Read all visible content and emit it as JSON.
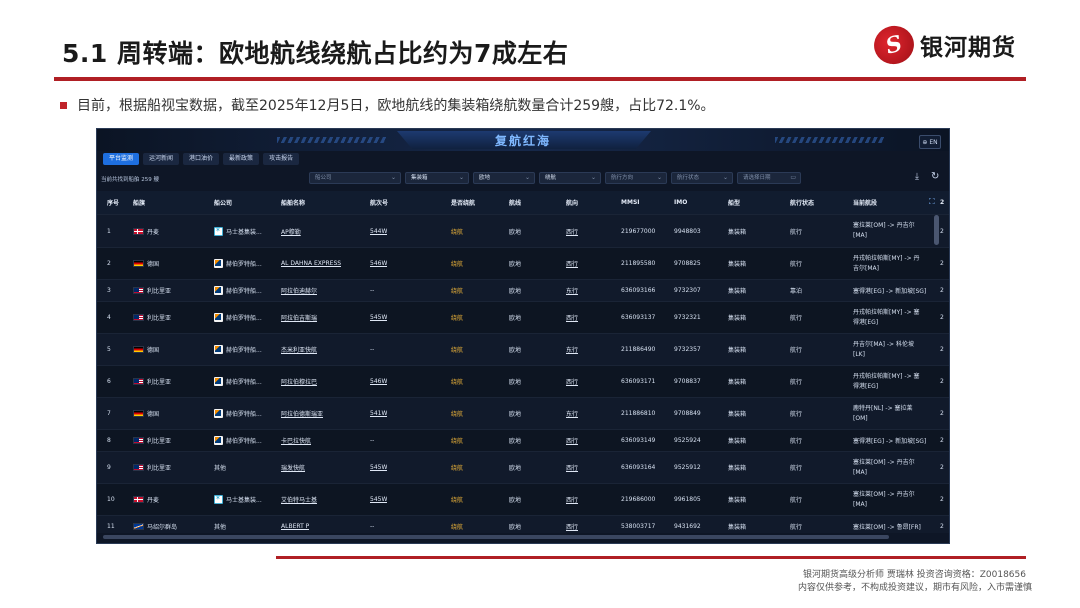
{
  "slide": {
    "title": "5.1 周转端：欧地航线绕航占比约为7成左右",
    "logo_text": "银河期货",
    "bullet": "目前，根据船视宝数据，截至2025年12月5日，欧地航线的集装箱绕航数量合计259艘，占比72.1%。",
    "footer_line1": "银河期货高级分析师 贾瑞林 投资咨询资格：Z0018656",
    "footer_line2": "内容仅供参考，不构成投资建议，期市有风险，入市需谨慎",
    "accent_color": "#b01f24"
  },
  "app": {
    "title": "复航红海",
    "lang_button": "⊕ EN",
    "tabs": [
      "平台监测",
      "运河新闻",
      "港口油价",
      "最新政策",
      "攻击报告"
    ],
    "count_text": "当前共找到船舶 259 艘",
    "filters": {
      "company": "船公司",
      "ship_type": "集装箱",
      "route": "欧地",
      "detour": "绕航",
      "direction": "航行方向",
      "status": "航行状态",
      "date": "请选择日期"
    },
    "columns": [
      "序号",
      "船旗",
      "船公司",
      "船舶名称",
      "航次号",
      "是否绕航",
      "航线",
      "航向",
      "MMSI",
      "IMO",
      "船型",
      "航行状态",
      "当前航段",
      "2"
    ],
    "rows": [
      {
        "no": "1",
        "flag": "丹麦",
        "company": "马士基集装...",
        "ship": "AP穆勒",
        "voyage": "544W",
        "detour": "绕航",
        "route": "欧地",
        "heading": "西行",
        "mmsi": "219677000",
        "imo": "9948803",
        "type": "集装箱",
        "status": "航行",
        "leg": "塞拉莱[OM] -> 丹吉尔",
        "leg2": "[MA]",
        "extra": "2"
      },
      {
        "no": "2",
        "flag": "德国",
        "company": "赫伯罗特船...",
        "ship": "AL DAHNA EXPRESS",
        "voyage": "546W",
        "detour": "绕航",
        "route": "欧地",
        "heading": "西行",
        "mmsi": "211895580",
        "imo": "9708825",
        "type": "集装箱",
        "status": "航行",
        "leg": "丹戎帕拉帕斯[MY] -> 丹",
        "leg2": "吉尔[MA]",
        "extra": "2"
      },
      {
        "no": "3",
        "flag": "利比里亚",
        "company": "赫伯罗特船...",
        "ship": "阿拉伯迪赫尔",
        "voyage": "--",
        "detour": "绕航",
        "route": "欧地",
        "heading": "东行",
        "mmsi": "636093166",
        "imo": "9732307",
        "type": "集装箱",
        "status": "靠泊",
        "leg": "塞得港[EG] -> 新加坡[SG]",
        "leg2": "",
        "extra": "2"
      },
      {
        "no": "4",
        "flag": "利比里亚",
        "company": "赫伯罗特船...",
        "ship": "阿拉伯吉斯瑞",
        "voyage": "545W",
        "detour": "绕航",
        "route": "欧地",
        "heading": "西行",
        "mmsi": "636093137",
        "imo": "9732321",
        "type": "集装箱",
        "status": "航行",
        "leg": "丹戎帕拉帕斯[MY] -> 塞",
        "leg2": "得港[EG]",
        "extra": "2"
      },
      {
        "no": "5",
        "flag": "德国",
        "company": "赫伯罗特船...",
        "ship": "杰米利亚快航",
        "voyage": "--",
        "detour": "绕航",
        "route": "欧地",
        "heading": "东行",
        "mmsi": "211886490",
        "imo": "9732357",
        "type": "集装箱",
        "status": "航行",
        "leg": "丹吉尔[MA] -> 科伦坡",
        "leg2": "[LK]",
        "extra": "2"
      },
      {
        "no": "6",
        "flag": "利比里亚",
        "company": "赫伯罗特船...",
        "ship": "阿拉伯穆拉巴",
        "voyage": "546W",
        "detour": "绕航",
        "route": "欧地",
        "heading": "西行",
        "mmsi": "636093171",
        "imo": "9708837",
        "type": "集装箱",
        "status": "航行",
        "leg": "丹戎帕拉帕斯[MY] -> 塞",
        "leg2": "得港[EG]",
        "extra": "2"
      },
      {
        "no": "7",
        "flag": "德国",
        "company": "赫伯罗特船...",
        "ship": "阿拉伯德斯瑞亚",
        "voyage": "541W",
        "detour": "绕航",
        "route": "欧地",
        "heading": "东行",
        "mmsi": "211886810",
        "imo": "9708849",
        "type": "集装箱",
        "status": "航行",
        "leg": "鹿特丹[NL] -> 塞拉莱",
        "leg2": "[OM]",
        "extra": "2"
      },
      {
        "no": "8",
        "flag": "利比里亚",
        "company": "赫伯罗特船...",
        "ship": "卡巴拉快航",
        "voyage": "--",
        "detour": "绕航",
        "route": "欧地",
        "heading": "西行",
        "mmsi": "636093149",
        "imo": "9525924",
        "type": "集装箱",
        "status": "航行",
        "leg": "塞得港[EG] -> 新加坡[SG]",
        "leg2": "",
        "extra": "2"
      },
      {
        "no": "9",
        "flag": "利比里亚",
        "company": "其他",
        "ship": "瑞发快航",
        "voyage": "545W",
        "detour": "绕航",
        "route": "欧地",
        "heading": "西行",
        "mmsi": "636093164",
        "imo": "9525912",
        "type": "集装箱",
        "status": "航行",
        "leg": "塞拉莱[OM] -> 丹吉尔",
        "leg2": "[MA]",
        "extra": "2"
      },
      {
        "no": "10",
        "flag": "丹麦",
        "company": "马士基集装...",
        "ship": "艾伯特马士基",
        "voyage": "545W",
        "detour": "绕航",
        "route": "欧地",
        "heading": "西行",
        "mmsi": "219686000",
        "imo": "9961805",
        "type": "集装箱",
        "status": "航行",
        "leg": "塞拉莱[OM] -> 丹吉尔",
        "leg2": "[MA]",
        "extra": "2"
      },
      {
        "no": "11",
        "flag": "马绍尔群岛",
        "company": "其他",
        "ship": "ALBERT P",
        "voyage": "--",
        "detour": "绕航",
        "route": "欧地",
        "heading": "西行",
        "mmsi": "538003717",
        "imo": "9431692",
        "type": "集装箱",
        "status": "航行",
        "leg": "塞拉莱[OM] -> 鲁昂[FR]",
        "leg2": "",
        "extra": "2"
      }
    ]
  }
}
